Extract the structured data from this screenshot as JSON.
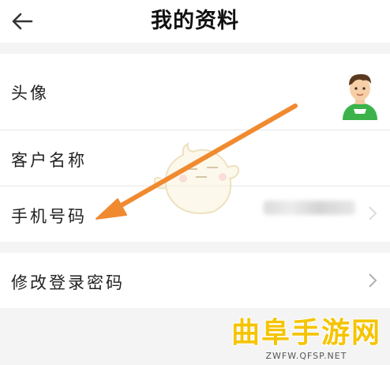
{
  "header": {
    "back_icon": "arrow-left-icon",
    "title": "我的资料"
  },
  "profile": {
    "avatar_label": "头像",
    "avatar_icon": "user-avatar-icon",
    "customer_name_label": "客户名称",
    "phone_label": "手机号码",
    "chevron_icon": "chevron-right-icon"
  },
  "security": {
    "change_password_label": "修改登录密码",
    "chevron_icon": "chevron-right-icon"
  },
  "watermark": {
    "title": "曲阜手游网",
    "subtitle": "ZWFW.QFSP.NET"
  },
  "colors": {
    "arrow": "#f08a30",
    "avatar_shirt": "#3cb34a",
    "watermark": "#f5c400"
  }
}
